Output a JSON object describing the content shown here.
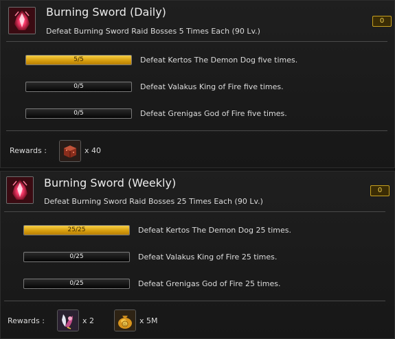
{
  "daily": {
    "title": "Burning Sword (Daily)",
    "subtitle": "Defeat Burning Sword Raid Bosses 5 Times Each (90 Lv.)",
    "badge": "0",
    "objectives": [
      {
        "progress_text": "5/5",
        "progress": 1.0,
        "label": "Defeat Kertos The Demon Dog five times."
      },
      {
        "progress_text": "0/5",
        "progress": 0.0,
        "label": "Defeat Valakus King of Fire five times."
      },
      {
        "progress_text": "0/5",
        "progress": 0.0,
        "label": "Defeat Grenigas God of Fire five times."
      }
    ],
    "rewards_label": "Rewards :",
    "rewards": [
      {
        "icon": "raid-box-icon",
        "qty": "x 40"
      }
    ]
  },
  "weekly": {
    "title": "Burning Sword (Weekly)",
    "subtitle": "Defeat Burning Sword Raid Bosses 25 Times Each (90 Lv.)",
    "badge": "0",
    "objectives": [
      {
        "progress_text": "25/25",
        "progress": 1.0,
        "label": "Defeat Kertos The Demon Dog 25 times."
      },
      {
        "progress_text": "0/25",
        "progress": 0.0,
        "label": "Defeat Valakus King of Fire 25 times."
      },
      {
        "progress_text": "0/25",
        "progress": 0.0,
        "label": "Defeat Grenigas God of Fire 25 times."
      }
    ],
    "rewards_label": "Rewards :",
    "rewards": [
      {
        "icon": "fairy-potion-icon",
        "qty": "x 2"
      },
      {
        "icon": "gold-pouch-icon",
        "qty": "x 5M"
      }
    ]
  },
  "colors": {
    "progress_fill": "#e0a81a",
    "badge_border": "#c9a21e",
    "panel_bg": "#1c1c1c"
  }
}
